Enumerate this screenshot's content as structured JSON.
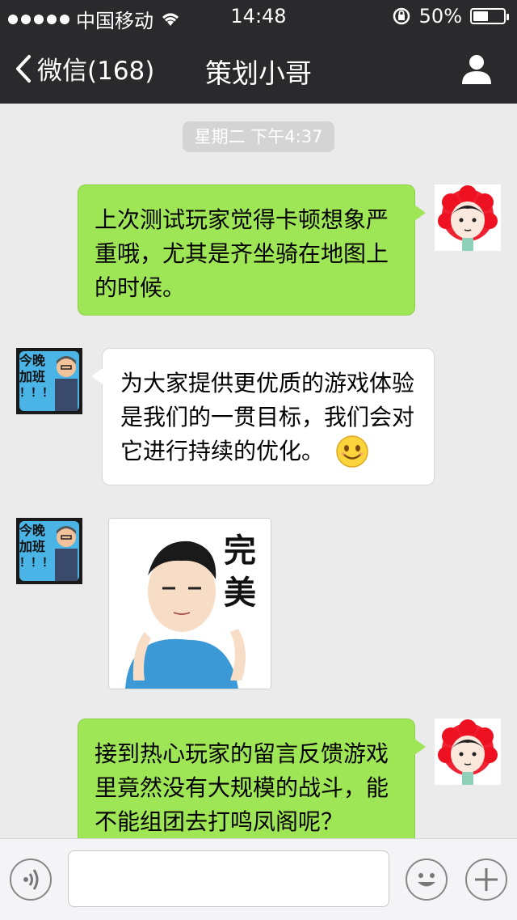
{
  "status_bar": {
    "carrier": "中国移动",
    "time": "14:48",
    "battery_text": "50%",
    "battery_level": 0.5
  },
  "nav": {
    "back_label": "微信(168)",
    "title": "策划小哥"
  },
  "chat": {
    "timestamp": "星期二 下午4:37",
    "messages": [
      {
        "direction": "sent",
        "type": "text",
        "lines": [
          "上次测试玩家觉得卡顿想象严",
          "重哦，尤其是齐坐骑在地图上",
          "的时候。"
        ]
      },
      {
        "direction": "received",
        "type": "text",
        "lines": [
          "为大家提供更优质的游戏体验",
          "是我们的一贯目标，我们会对",
          "它进行持续的优化。"
        ],
        "emoji": "smile"
      },
      {
        "direction": "received",
        "type": "sticker",
        "sticker_text": "完美"
      },
      {
        "direction": "sent",
        "type": "text",
        "lines": [
          "接到热心玩家的留言反馈游戏",
          "里竟然没有大规模的战斗，能",
          "不能组团去打鸣凤阁呢？"
        ]
      }
    ]
  },
  "avatars": {
    "received_avatar_text_1": "今晚",
    "received_avatar_text_2": "加班",
    "received_avatar_text_3": "！！！"
  },
  "colors": {
    "header_bg": "#2a2a2c",
    "sent_bubble": "#9fe657",
    "chat_bg": "#ebebeb"
  }
}
